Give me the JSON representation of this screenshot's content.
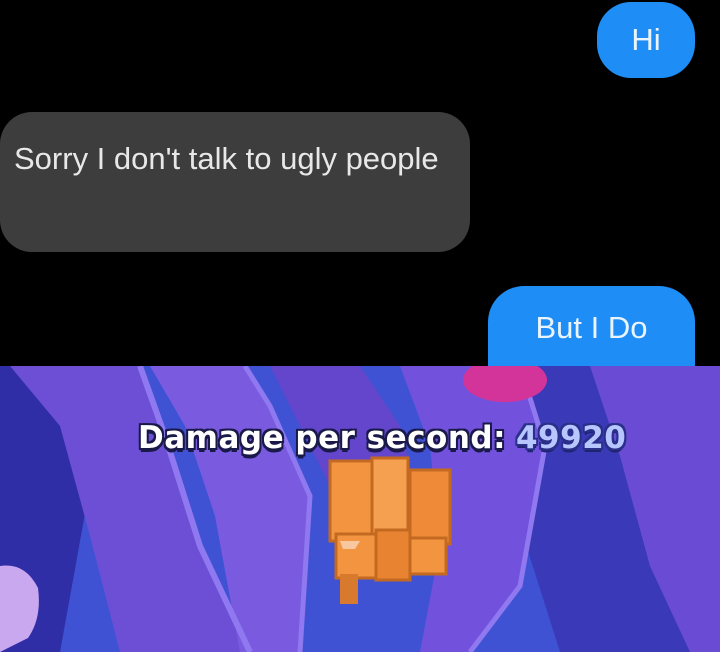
{
  "chat": {
    "messages": [
      {
        "sender": "me",
        "text": "Hi"
      },
      {
        "sender": "other",
        "text": "Sorry I don't talk to ugly people"
      },
      {
        "sender": "me",
        "text": "But I Do"
      }
    ],
    "colors": {
      "sent": "#1e8df5",
      "received": "#3d3d3d",
      "background": "#000000"
    }
  },
  "game": {
    "stat_label": "Damage per second:",
    "stat_value": "49920",
    "colors": {
      "wall": "#6a4fd8",
      "floor": "#3d4fd0",
      "crate": "#f08a3a"
    }
  }
}
